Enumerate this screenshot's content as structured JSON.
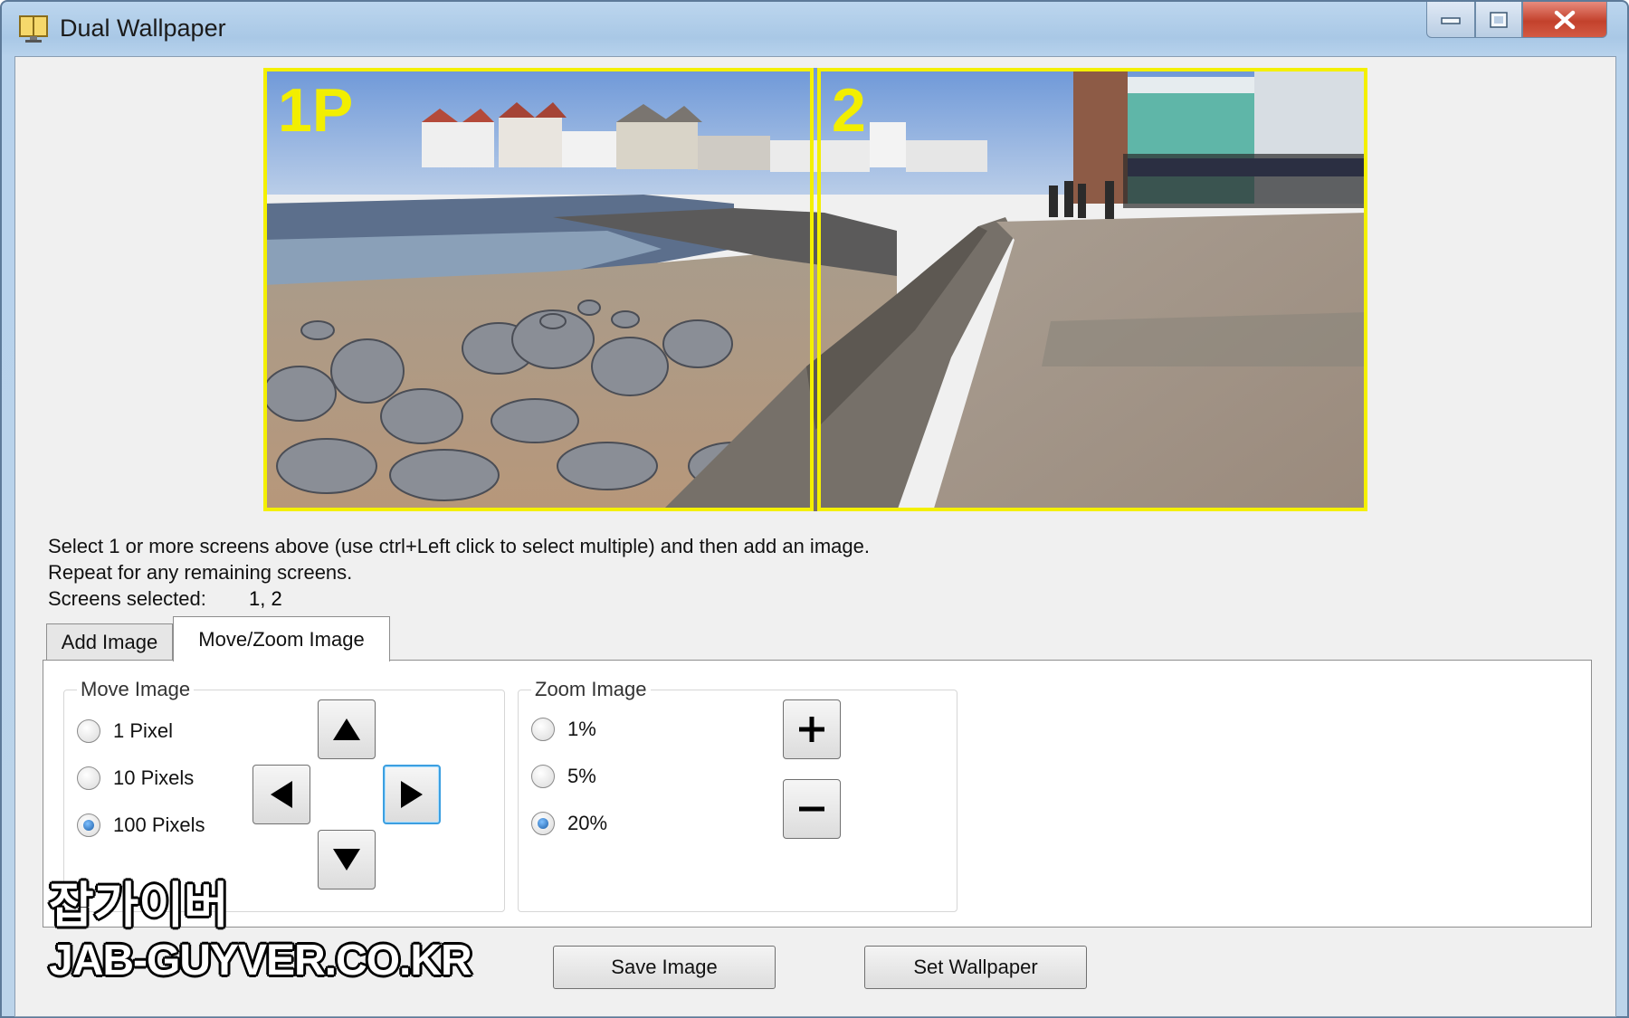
{
  "window": {
    "title": "Dual Wallpaper"
  },
  "preview": {
    "screen1_label": "1P",
    "screen2_label": "2"
  },
  "instructions": {
    "line1": "Select 1 or more screens above (use ctrl+Left click to select multiple) and then add an image.",
    "line2": "Repeat for any remaining screens.",
    "line3": "Screens selected:",
    "screens_selected": "1, 2"
  },
  "tabs": [
    {
      "label": "Add Image",
      "active": false
    },
    {
      "label": "Move/Zoom Image",
      "active": true
    }
  ],
  "move_group": {
    "legend": "Move Image",
    "options": [
      {
        "label": "1 Pixel",
        "checked": false
      },
      {
        "label": "10 Pixels",
        "checked": false
      },
      {
        "label": "100 Pixels",
        "checked": true
      }
    ],
    "buttons": [
      "up-arrow-icon",
      "left-arrow-icon",
      "right-arrow-icon",
      "down-arrow-icon"
    ]
  },
  "zoom_group": {
    "legend": "Zoom Image",
    "options": [
      {
        "label": "1%",
        "checked": false
      },
      {
        "label": "5%",
        "checked": false
      },
      {
        "label": "20%",
        "checked": true
      }
    ],
    "buttons": [
      "plus-icon",
      "minus-icon"
    ]
  },
  "actions": {
    "save_label": "Save Image",
    "set_label": "Set Wallpaper"
  },
  "watermark": {
    "line1": "잡가이버",
    "line2": "JAB-GUYVER.CO.KR"
  },
  "colors": {
    "screen_border": "#f4f000",
    "focus": "#3c9fe0",
    "close_button": "#c3412c"
  }
}
